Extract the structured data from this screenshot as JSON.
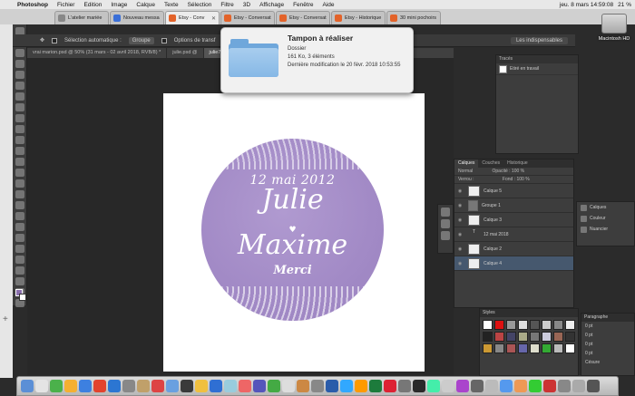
{
  "menubar": {
    "apple": "",
    "items": [
      "Photoshop",
      "Fichier",
      "Edition",
      "Image",
      "Calque",
      "Texte",
      "Sélection",
      "Filtre",
      "3D",
      "Affichage",
      "Fenêtre",
      "Aide"
    ],
    "clock": "jeu. 8 mars  14:59:08",
    "battery": "21 %"
  },
  "browser_tabs": [
    {
      "label": "L'atelier mariée",
      "icon": "gray"
    },
    {
      "label": "Nouveau messa",
      "icon": "blue"
    },
    {
      "label": "Etsy - Conv",
      "icon": "orange",
      "active": true
    },
    {
      "label": "Etsy - Conversat",
      "icon": "orange"
    },
    {
      "label": "Etsy - Conversat",
      "icon": "orange"
    },
    {
      "label": "Etsy - Historique",
      "icon": "orange"
    },
    {
      "label": "30 mini pochoirs",
      "icon": "orange"
    }
  ],
  "options_bar": {
    "auto_select_label": "Sélection automatique :",
    "auto_select_value": "Groupe",
    "transform_label": "Options de transf",
    "workspace": "Les indispensables"
  },
  "doc_tabs": [
    {
      "label": "vrai marion.psd @ 50% (31 mars - 02 avril 2018, RVB/8) *",
      "active": false
    },
    {
      "label": "julie.psd @",
      "active": false
    },
    {
      "label": "julie77.psd @",
      "active": true
    }
  ],
  "artwork": {
    "date": "12 mai 2012",
    "name1": "Julie",
    "heart": "♥",
    "name2": "Maxime",
    "merci": "Merci"
  },
  "tooltip": {
    "title": "Tampon à réaliser",
    "kind": "Dossier",
    "size": "161 Ko, 3 éléments",
    "modified": "Dernière modification le 20 févr. 2018 10:53:55"
  },
  "history_panel": {
    "header": "Tracés",
    "row": "Etiré en travail"
  },
  "layers_panel": {
    "tabs": [
      "Calques",
      "Couches",
      "Historique"
    ],
    "mode": "Normal",
    "opacity": "Opacité : 100 %",
    "lock": "Verrou :",
    "fill": "Fond : 100 %",
    "rows": [
      {
        "name": "Calque 5",
        "type": "pixel",
        "selected": false
      },
      {
        "name": "Groupe 1",
        "type": "group",
        "selected": false
      },
      {
        "name": "Calque 3",
        "type": "pixel",
        "selected": false
      },
      {
        "name": "12 mai 2018",
        "type": "text",
        "selected": false
      },
      {
        "name": "Calque 2",
        "type": "pixel",
        "selected": false
      },
      {
        "name": "Calque 4",
        "type": "pixel",
        "selected": true
      }
    ]
  },
  "right_mini": [
    "Calques",
    "Couleur",
    "Nuancier"
  ],
  "styles_panel": {
    "header": "Styles",
    "swatches": [
      "#ffffff",
      "#d11",
      "#999",
      "#ddd",
      "#555",
      "#ccc",
      "#888",
      "#eee",
      "#222",
      "#b44",
      "#446",
      "#aa8",
      "#777",
      "#ccd",
      "#965",
      "#333",
      "#c93",
      "#888",
      "#a55",
      "#66a",
      "#ddc",
      "#3a3",
      "#bbb",
      "#fff"
    ]
  },
  "paragraph_panel": {
    "header": "Paragraphe",
    "rows": [
      "0 pt",
      "0 pt",
      "0 pt",
      "0 pt"
    ],
    "footer": "Césure"
  },
  "desktop": {
    "drive_label": "Macintosh HD"
  },
  "dock_colors": [
    "#5b8fd6",
    "#e4e4e4",
    "#4bb14b",
    "#f5b031",
    "#3d80e0",
    "#e2432e",
    "#2c76d2",
    "#888",
    "#c0a06a",
    "#d44",
    "#6aa0e0",
    "#3a3a3a",
    "#f0c040",
    "#2f6fd3",
    "#9cd",
    "#e66",
    "#55b",
    "#4a4",
    "#ddd",
    "#c84",
    "#888",
    "#2a5caa",
    "#31a8ff",
    "#ff9a00",
    "#1d7b3c",
    "#d23",
    "#777",
    "#2a2a2a",
    "#4ea",
    "#ccc",
    "#a4c",
    "#666",
    "#bbb",
    "#59e",
    "#e95",
    "#3c3",
    "#c33",
    "#888",
    "#aaa",
    "#555"
  ]
}
